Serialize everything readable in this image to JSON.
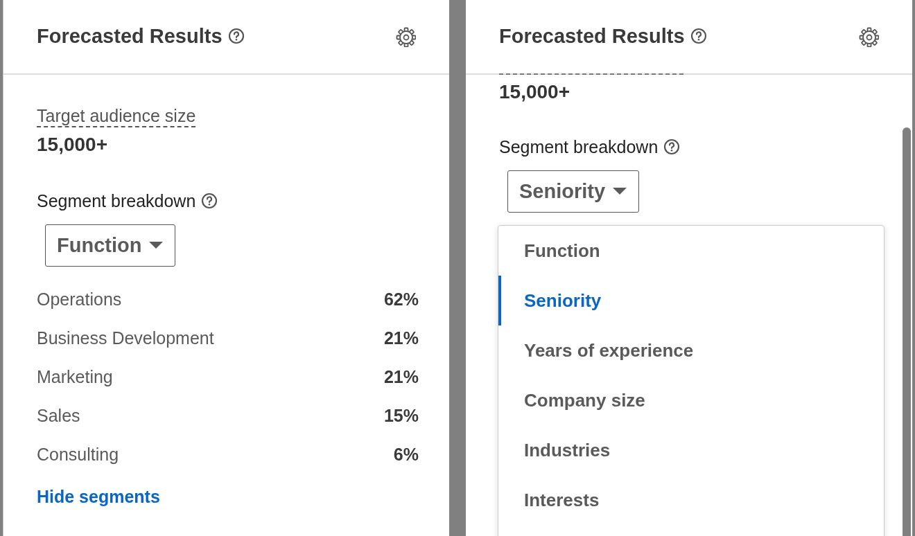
{
  "panels": [
    {
      "kind": "segments",
      "title": "Forecasted Results",
      "audience_label": "Target audience size",
      "audience_value": "15,000+",
      "segment_label": "Segment breakdown",
      "dropdown_value": "Function",
      "segments": [
        {
          "name": "Operations",
          "value": "62%"
        },
        {
          "name": "Business Development",
          "value": "21%"
        },
        {
          "name": "Marketing",
          "value": "21%"
        },
        {
          "name": "Sales",
          "value": "15%"
        },
        {
          "name": "Consulting",
          "value": "6%"
        }
      ],
      "link": "Hide segments"
    },
    {
      "kind": "menu",
      "title": "Forecasted Results",
      "audience_value": "15,000+",
      "segment_label": "Segment breakdown",
      "dropdown_value": "Seniority",
      "options": [
        {
          "label": "Function",
          "selected": false
        },
        {
          "label": "Seniority",
          "selected": true
        },
        {
          "label": "Years of experience",
          "selected": false
        },
        {
          "label": "Company size",
          "selected": false
        },
        {
          "label": "Industries",
          "selected": false
        },
        {
          "label": "Interests",
          "selected": false
        }
      ]
    }
  ]
}
